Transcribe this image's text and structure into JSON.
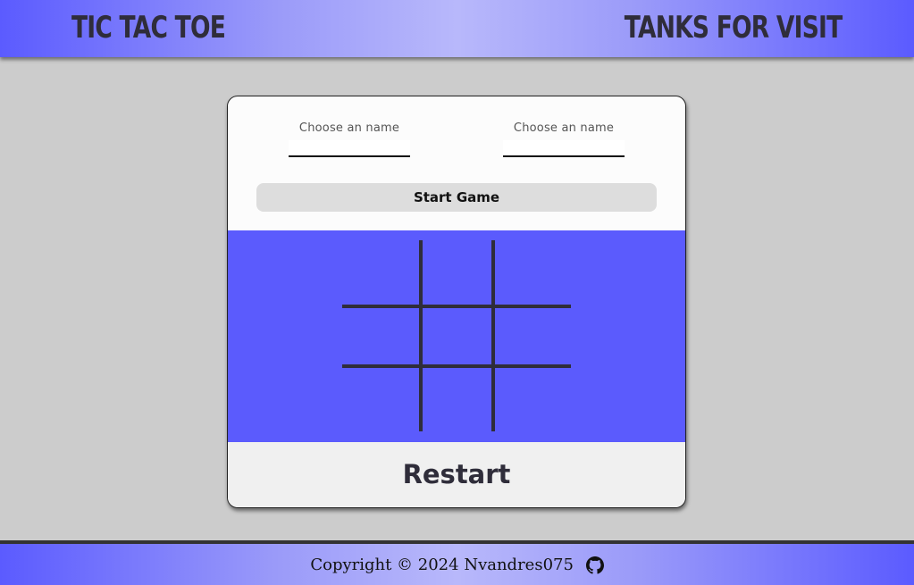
{
  "header": {
    "left_title": "TIC TAC TOE",
    "right_title": "TANKS FOR VISIT"
  },
  "players": [
    {
      "label": "Choose an name",
      "value": ""
    },
    {
      "label": "Choose an name",
      "value": ""
    }
  ],
  "controls": {
    "start_label": "Start Game",
    "restart_label": "Restart"
  },
  "board": {
    "cells": [
      "",
      "",
      "",
      "",
      "",
      "",
      "",
      "",
      ""
    ]
  },
  "footer": {
    "copyright": "Copyright © 2024 Nvandres075",
    "icon": "github-icon"
  },
  "colors": {
    "accent": "#5b5bfd",
    "grid": "#2f2d3a",
    "background": "#cccccc"
  }
}
